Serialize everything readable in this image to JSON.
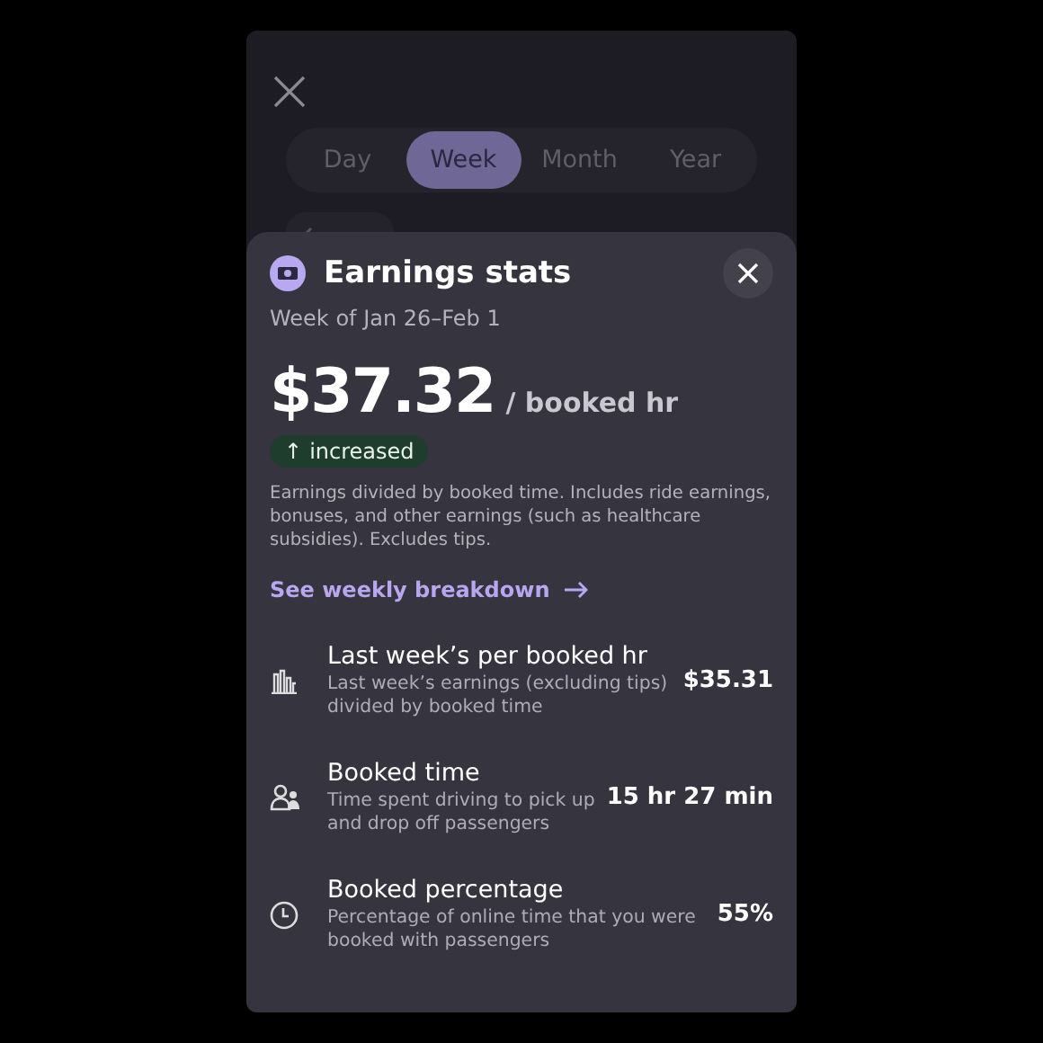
{
  "background": {
    "tabs": [
      {
        "label": "Day",
        "selected": false
      },
      {
        "label": "Week",
        "selected": true
      },
      {
        "label": "Month",
        "selected": false
      },
      {
        "label": "Year",
        "selected": false
      }
    ]
  },
  "sheet": {
    "title": "Earnings stats",
    "subtitle": "Week of Jan 26–Feb 1",
    "amount": "$37.32",
    "unit": "/ booked hr",
    "trend": {
      "arrow": "↑",
      "label": "increased"
    },
    "description": "Earnings divided by booked time. Includes ride earnings, bonuses, and other earnings (such as healthcare subsidies). Excludes tips.",
    "link": "See weekly breakdown",
    "stats": [
      {
        "kind": "chart",
        "title": "Last week’s per booked hr",
        "detail": "Last week’s earnings (excluding tips) divided by booked time",
        "value": "$35.31"
      },
      {
        "kind": "people",
        "title": "Booked time",
        "detail": "Time spent driving to pick up and drop off passengers",
        "value": "15 hr 27 min"
      },
      {
        "kind": "clock",
        "title": "Booked percentage",
        "detail": "Percentage of online time that you were booked with passengers",
        "value": "55%"
      }
    ]
  }
}
